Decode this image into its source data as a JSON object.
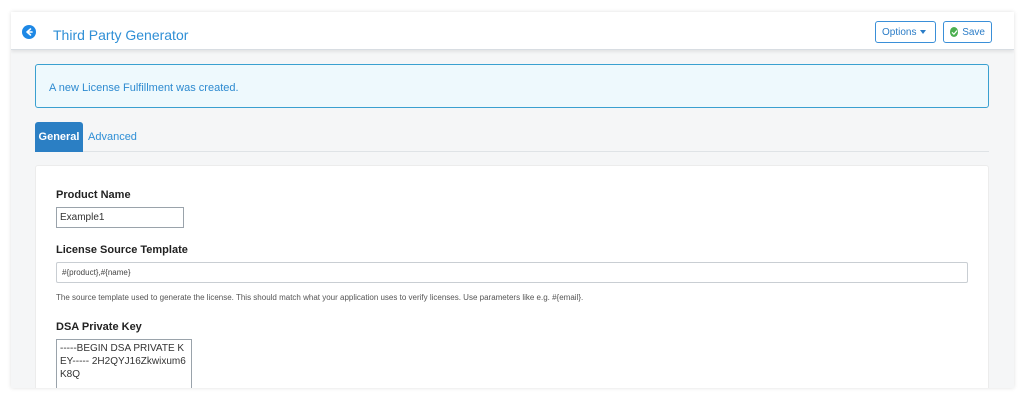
{
  "header": {
    "title": "Third Party Generator",
    "options_label": "Options",
    "save_label": "Save"
  },
  "alert": {
    "message": "A new License Fulfillment was created."
  },
  "tabs": [
    {
      "label": "General",
      "active": true
    },
    {
      "label": "Advanced",
      "active": false
    }
  ],
  "form": {
    "product_name": {
      "label": "Product Name",
      "value": "Example1"
    },
    "license_source_template": {
      "label": "License Source Template",
      "value": "#{product},#{name}",
      "help": "The source template used to generate the license. This should match what your application uses to verify licenses. Use parameters like e.g. #{email}."
    },
    "dsa_private_key": {
      "label": "DSA Private Key",
      "value": "-----BEGIN DSA PRIVATE KEY----- 2H2QYJ16Zkwixum6K8Q"
    }
  },
  "colors": {
    "accent": "#2f8fd6",
    "active_tab": "#2b7fc4",
    "save_check": "#4caf50",
    "alert_border": "#3aa0d0"
  },
  "icons": {
    "back": "arrow-left-circle-icon",
    "options": "caret-down-icon",
    "save": "check-circle-icon"
  }
}
